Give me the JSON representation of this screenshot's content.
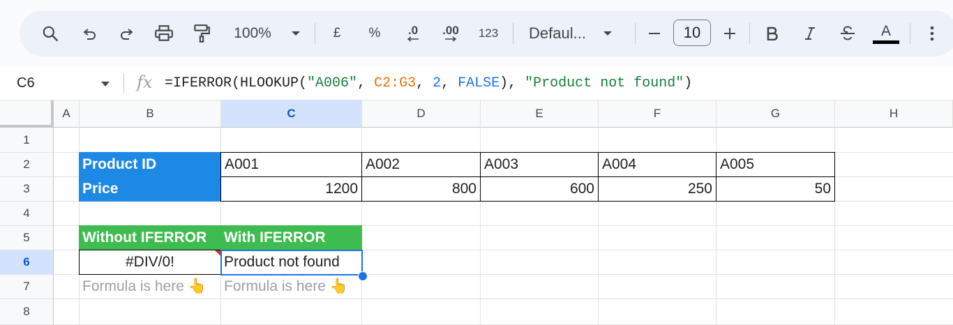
{
  "toolbar": {
    "zoom": "100%",
    "currency": "£",
    "percent": "%",
    "decrease_decimal": ".0",
    "increase_decimal": ".00",
    "number_format": "123",
    "font": "Defaul...",
    "font_size": "10",
    "text_color_letter": "A"
  },
  "formula_bar": {
    "cell_ref": "C6",
    "fx": "fx",
    "f_prefix": "=IFERROR(HLOOKUP(",
    "f_lookup": "\"A006\"",
    "f_sep1": ", ",
    "f_range": "C2:G3",
    "f_sep2": ", ",
    "f_index": "2",
    "f_sep3": ", ",
    "f_bool": "FALSE",
    "f_sep4": "), ",
    "f_msg": "\"Product not found\"",
    "f_close": ")"
  },
  "columns": [
    "A",
    "B",
    "C",
    "D",
    "E",
    "F",
    "G",
    "H"
  ],
  "rows": [
    "1",
    "2",
    "3",
    "4",
    "5",
    "6",
    "7",
    "8"
  ],
  "selected_cell": "C6",
  "table": {
    "row2": [
      "Product ID",
      "A001",
      "A002",
      "A003",
      "A004",
      "A005"
    ],
    "row3": [
      "Price",
      "1200",
      "800",
      "600",
      "250",
      "50"
    ]
  },
  "demo": {
    "b5": "Without IFERROR",
    "c5": "With IFERROR",
    "b6": "#DIV/0!",
    "c6": "Product not found",
    "b7": "Formula is here 👆",
    "c7": "Formula is here 👆"
  },
  "colors": {
    "header_blue": "#1e88e5",
    "header_green": "#3fbc4f",
    "selection": "#1a73e8",
    "error_triangle": "#d93025"
  }
}
